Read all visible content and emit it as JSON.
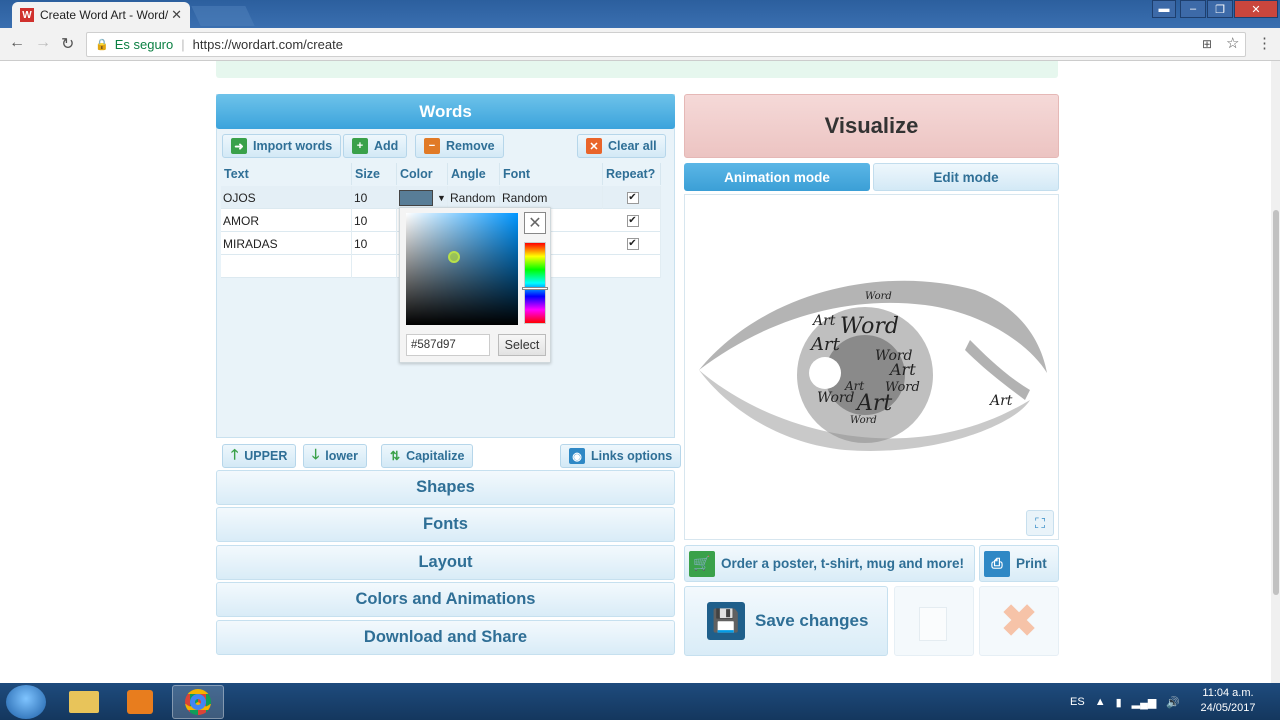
{
  "browser": {
    "tab_title": "Create Word Art - Word/",
    "favicon_letter": "W",
    "secure_label": "Es seguro",
    "url": "https://wordart.com/create"
  },
  "words_panel": {
    "title": "Words",
    "toolbar": {
      "import": "Import words",
      "add": "Add",
      "remove": "Remove",
      "clear_all": "Clear all"
    },
    "columns": [
      "Text",
      "Size",
      "Color",
      "Angle",
      "Font",
      "Repeat?"
    ],
    "rows": [
      {
        "text": "OJOS",
        "size": "10",
        "angle": "Random",
        "font": "Random",
        "repeat": true
      },
      {
        "text": "AMOR",
        "size": "10",
        "angle": "",
        "font": "",
        "repeat": true
      },
      {
        "text": "MIRADAS",
        "size": "10",
        "angle": "",
        "font": "",
        "repeat": true
      }
    ],
    "case_buttons": {
      "upper": "UPPER",
      "lower": "lower",
      "capitalize": "Capitalize",
      "links": "Links options"
    }
  },
  "color_picker": {
    "hex_value": "#587d97",
    "select_label": "Select",
    "swatch_color": "#587d97"
  },
  "accordion": [
    "Shapes",
    "Fonts",
    "Layout",
    "Colors and Animations",
    "Download and Share"
  ],
  "right": {
    "visualize": "Visualize",
    "animation_mode": "Animation mode",
    "edit_mode": "Edit mode",
    "order": "Order a poster, t-shirt, mug and more!",
    "print": "Print",
    "save": "Save changes",
    "canvas_words": [
      "Word",
      "Art",
      "Word",
      "Art",
      "Word",
      "Art",
      "Art",
      "Word",
      "Art",
      "Word",
      "Art",
      "Word"
    ]
  },
  "taskbar": {
    "lang": "ES",
    "time": "11:04 a.m.",
    "date": "24/05/2017"
  }
}
